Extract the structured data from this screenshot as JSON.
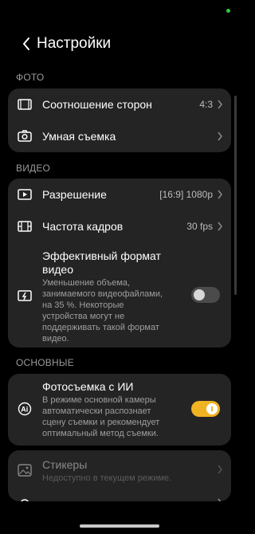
{
  "header": {
    "title": "Настройки"
  },
  "sections": {
    "photo": "ФОТО",
    "video": "ВИДЕО",
    "main": "ОСНОВНЫЕ"
  },
  "photo": {
    "aspect_label": "Соотношение сторон",
    "aspect_value": "4:3",
    "smart_label": "Умная съемка"
  },
  "video": {
    "resolution_label": "Разрешение",
    "resolution_value": "[16:9] 1080p",
    "fps_label": "Частота кадров",
    "fps_value": "30 fps",
    "efficient_label_1": "Эффективный формат",
    "efficient_label_2": "видео",
    "efficient_desc": [
      "Уменьшение объема,",
      "занимаемого видеофайлами,",
      "на 35 %. Некоторые",
      "устройства могут не",
      "поддерживать такой формат",
      "видео."
    ],
    "efficient_enabled": false
  },
  "main": {
    "ai_label": "Фотосъемка с ИИ",
    "ai_desc": [
      "В режиме основной камеры",
      "автоматически распознает",
      "сцену съемки и рекомендует",
      "оптимальный метод съемки."
    ],
    "ai_enabled": true
  },
  "extra": {
    "stickers_label": "Стикеры",
    "stickers_desc": "Недоступно в текущем режиме."
  },
  "colors": {
    "accent": "#f0b323",
    "card": "#242424",
    "background": "#000000"
  }
}
